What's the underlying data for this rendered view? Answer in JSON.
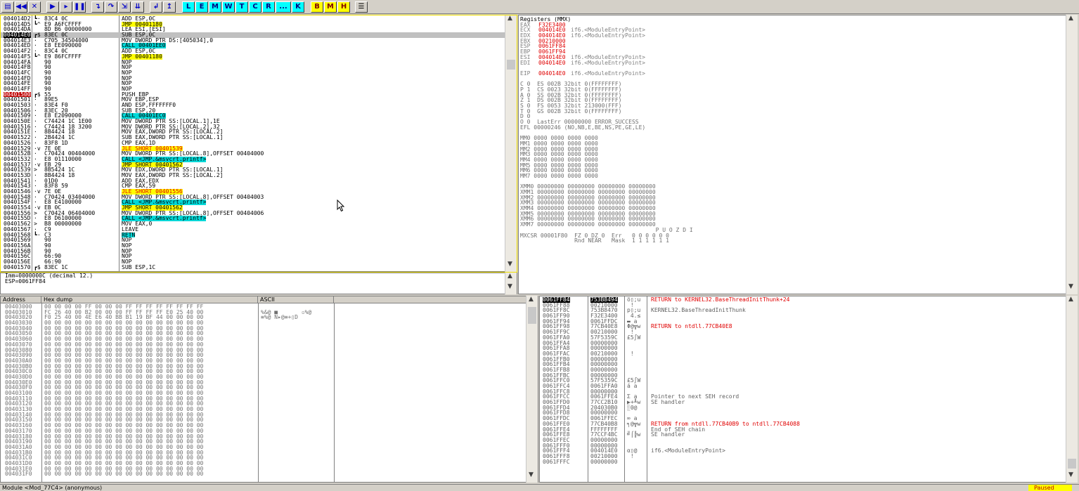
{
  "toolbar": {
    "buttons": [
      {
        "name": "open-icon",
        "glyph": "▤"
      },
      {
        "name": "restart-icon",
        "glyph": "◀◀"
      },
      {
        "name": "close-icon",
        "glyph": "✕"
      },
      {
        "name": "run-icon",
        "glyph": "▶"
      },
      {
        "name": "step-icon",
        "glyph": "▸"
      },
      {
        "name": "pause-icon",
        "glyph": "❚❚"
      },
      {
        "name": "step-into-icon",
        "glyph": "↴"
      },
      {
        "name": "step-over-icon",
        "glyph": "↷"
      },
      {
        "name": "trace-into-icon",
        "glyph": "⇲"
      },
      {
        "name": "trace-over-icon",
        "glyph": "⇊"
      },
      {
        "name": "execute-till-return-icon",
        "glyph": "↲"
      },
      {
        "name": "go-to-icon",
        "glyph": "↥"
      }
    ],
    "letters_cyan": [
      "L",
      "E",
      "M",
      "W",
      "T",
      "C",
      "R",
      "...",
      "K"
    ],
    "letters_yellow": [
      "B",
      "M",
      "H"
    ],
    "menu_glyph": "☰"
  },
  "cpu": {
    "rows": [
      {
        "addr": "004014D2",
        "br": "┗·",
        "hex": "83C4 0C",
        "asm": "ADD ESP,0C"
      },
      {
        "addr": "004014D5",
        "br": "┗^",
        "hex": "E9 A6FCFFFF",
        "asm": "JMP 00401180",
        "t": "yjmp"
      },
      {
        "addr": "004014DA",
        "br": " ",
        "hex": "8D B6 00000000",
        "asm": "LEA ESI,[ESI]"
      },
      {
        "addr": "004014E0",
        "br": "┏$",
        "hex": "83EC 0C",
        "asm": "SUB ESP,0C",
        "sel": true
      },
      {
        "addr": "004014E3",
        "br": "·",
        "hex": "C705 34504000",
        "asm": "MOV DWORD PTR DS:[405034],0"
      },
      {
        "addr": "004014ED",
        "br": "·",
        "hex": "E8 EE090000",
        "asm": "CALL 00401EE0",
        "t": "ycall"
      },
      {
        "addr": "004014F2",
        "br": "·",
        "hex": "83C4 0C",
        "asm": "ADD ESP,0C"
      },
      {
        "addr": "004014F5",
        "br": "┗^",
        "hex": "E9 86FCFFFF",
        "asm": "JMP 00401180",
        "t": "yjmp"
      },
      {
        "addr": "004014FA",
        "br": " ",
        "hex": "90",
        "asm": "NOP"
      },
      {
        "addr": "004014FB",
        "br": " ",
        "hex": "90",
        "asm": "NOP"
      },
      {
        "addr": "004014FC",
        "br": " ",
        "hex": "90",
        "asm": "NOP"
      },
      {
        "addr": "004014FD",
        "br": " ",
        "hex": "90",
        "asm": "NOP"
      },
      {
        "addr": "004014FE",
        "br": " ",
        "hex": "90",
        "asm": "NOP"
      },
      {
        "addr": "004014FF",
        "br": " ",
        "hex": "90",
        "asm": "NOP"
      },
      {
        "addr": "00401500",
        "br": "┏$",
        "hex": "55",
        "asm": "PUSH EBP",
        "bp": true
      },
      {
        "addr": "00401501",
        "br": "·",
        "hex": "89E5",
        "asm": "MOV EBP,ESP"
      },
      {
        "addr": "00401503",
        "br": "·",
        "hex": "83E4 F0",
        "asm": "AND ESP,FFFFFFF0"
      },
      {
        "addr": "00401506",
        "br": "·",
        "hex": "83EC 20",
        "asm": "SUB ESP,20"
      },
      {
        "addr": "00401509",
        "br": "·",
        "hex": "E8 E2090000",
        "asm": "CALL 00401EC0",
        "t": "ycall"
      },
      {
        "addr": "0040150E",
        "br": "·",
        "hex": "C74424 1C 1E00",
        "asm": "MOV DWORD PTR SS:[LOCAL.1],1E"
      },
      {
        "addr": "00401516",
        "br": "·",
        "hex": "C74424 18 3200",
        "asm": "MOV DWORD PTR SS:[LOCAL.2],32"
      },
      {
        "addr": "0040151E",
        "br": "·",
        "hex": "8B4424 18",
        "asm": "MOV EAX,DWORD PTR SS:[LOCAL.2]"
      },
      {
        "addr": "00401522",
        "br": "·",
        "hex": "2B4424 1C",
        "asm": "SUB EAX,DWORD PTR SS:[LOCAL.1]"
      },
      {
        "addr": "00401526",
        "br": "·",
        "hex": "83F8 1D",
        "asm": "CMP EAX,1D"
      },
      {
        "addr": "00401529",
        "br": "·v",
        "hex": "7E 0E",
        "asm": "JLE SHORT 00401539",
        "t": "yjmp",
        "red": true
      },
      {
        "addr": "0040152B",
        "br": "·",
        "hex": "C70424 00404000",
        "asm": "MOV DWORD PTR SS:[LOCAL.8],OFFSET 00404000"
      },
      {
        "addr": "00401532",
        "br": "·",
        "hex": "E8 01110000",
        "asm": "CALL <JMP.&msvcrt.printf>",
        "t": "ycall"
      },
      {
        "addr": "00401537",
        "br": "·v",
        "hex": "EB 29",
        "asm": "JMP SHORT 00401562",
        "t": "yjmp"
      },
      {
        "addr": "00401539",
        "br": ">",
        "hex": "8B5424 1C",
        "asm": "MOV EDX,DWORD PTR SS:[LOCAL.1]"
      },
      {
        "addr": "0040153D",
        "br": "·",
        "hex": "8B4424 18",
        "asm": "MOV EAX,DWORD PTR SS:[LOCAL.2]"
      },
      {
        "addr": "00401541",
        "br": "·",
        "hex": "01D0",
        "asm": "ADD EAX,EDX"
      },
      {
        "addr": "00401543",
        "br": "·",
        "hex": "83F8 59",
        "asm": "CMP EAX,59"
      },
      {
        "addr": "00401546",
        "br": "·v",
        "hex": "7E 0E",
        "asm": "JLE SHORT 00401556",
        "t": "yjmp",
        "red": true
      },
      {
        "addr": "00401548",
        "br": "·",
        "hex": "C70424 03404000",
        "asm": "MOV DWORD PTR SS:[LOCAL.8],OFFSET 00404003"
      },
      {
        "addr": "0040154F",
        "br": "·",
        "hex": "E8 E4100000",
        "asm": "CALL <JMP.&msvcrt.printf>",
        "t": "ycall"
      },
      {
        "addr": "00401554",
        "br": "·v",
        "hex": "EB 0C",
        "asm": "JMP SHORT 00401562",
        "t": "yjmp"
      },
      {
        "addr": "00401556",
        "br": ">",
        "hex": "C70424 06404000",
        "asm": "MOV DWORD PTR SS:[LOCAL.8],OFFSET 00404006"
      },
      {
        "addr": "0040155D",
        "br": "·",
        "hex": "E8 D6100000",
        "asm": "CALL <JMP.&msvcrt.printf>",
        "t": "ycall"
      },
      {
        "addr": "00401562",
        "br": ">",
        "hex": "B8 00000000",
        "asm": "MOV EAX,0"
      },
      {
        "addr": "00401567",
        "br": "·",
        "hex": "C9",
        "asm": "LEAVE"
      },
      {
        "addr": "00401568",
        "br": "┗·",
        "hex": "C3",
        "asm": "RETN",
        "t": "ycall"
      },
      {
        "addr": "00401569",
        "br": " ",
        "hex": "90",
        "asm": "NOP"
      },
      {
        "addr": "0040156A",
        "br": " ",
        "hex": "90",
        "asm": "NOP"
      },
      {
        "addr": "0040156B",
        "br": " ",
        "hex": "90",
        "asm": "NOP"
      },
      {
        "addr": "0040156C",
        "br": " ",
        "hex": "66:90",
        "asm": "NOP"
      },
      {
        "addr": "0040156E",
        "br": " ",
        "hex": "66:90",
        "asm": "NOP"
      },
      {
        "addr": "00401570",
        "br": "┏$",
        "hex": "83EC 1C",
        "asm": "SUB ESP,1C"
      }
    ],
    "info_line1": "Imm=0000000C (decimal 12.)",
    "info_line2": "ESP=0061FF84"
  },
  "registers": {
    "title": "Registers (MMX)",
    "gp": [
      {
        "name": "EAX",
        "val": "F32E3400",
        "c": "",
        "changed": true
      },
      {
        "name": "ECX",
        "val": "004014E0",
        "c": "if6.<ModuleEntryPoint>",
        "changed": true
      },
      {
        "name": "EDX",
        "val": "004014E0",
        "c": "if6.<ModuleEntryPoint>",
        "changed": true
      },
      {
        "name": "EBX",
        "val": "00210000",
        "c": "",
        "changed": true
      },
      {
        "name": "ESP",
        "val": "0061FF84",
        "c": "",
        "changed": true
      },
      {
        "name": "EBP",
        "val": "0061FF94",
        "c": "",
        "changed": true
      },
      {
        "name": "ESI",
        "val": "004014E0",
        "c": "if6.<ModuleEntryPoint>",
        "changed": true
      },
      {
        "name": "EDI",
        "val": "004014E0",
        "c": "if6.<ModuleEntryPoint>",
        "changed": true
      }
    ],
    "eip": {
      "name": "EIP",
      "val": "004014E0",
      "c": "if6.<ModuleEntryPoint>"
    },
    "flags": [
      "C 0  ES 002B 32bit 0(FFFFFFFF)",
      "P 1  CS 0023 32bit 0(FFFFFFFF)",
      "A 0  SS 002B 32bit 0(FFFFFFFF)",
      "Z 1  DS 002B 32bit 0(FFFFFFFF)",
      "S 0  FS 0053 32bit 213000(FFF)",
      "T 0  GS 002B 32bit 0(FFFFFFFF)",
      "D 0",
      "O 0  LastErr 00000000 ERROR_SUCCESS"
    ],
    "efl": "EFL 00000246 (NO,NB,E,BE,NS,PE,GE,LE)",
    "mm": [
      "MM0 0000 0000 0000 0000",
      "MM1 0000 0000 0000 0000",
      "MM2 0000 0000 0000 0000",
      "MM3 0000 0000 0000 0000",
      "MM4 0000 0000 0000 0000",
      "MM5 0000 0000 0000 0000",
      "MM6 0000 0000 0000 0000",
      "MM7 0000 0000 0000 0000"
    ],
    "xmm": [
      "XMM0 00000000 00000000 00000000 00000000",
      "XMM1 00000000 00000000 00000000 00000000",
      "XMM2 00000000 00000000 00000000 00000000",
      "XMM3 00000000 00000000 00000000 00000000",
      "XMM4 00000000 00000000 00000000 00000000",
      "XMM5 00000000 00000000 00000000 00000000",
      "XMM6 00000000 00000000 00000000 00000000",
      "XMM7 00000000 00000000 00000000 00000000"
    ],
    "mxcsr1": "                                        P U O Z D I",
    "mxcsr2": "MXCSR 00001F80  FZ 0 DZ 0  Err   0 0 0 0 0 0",
    "mxcsr3": "                Rnd NEAR   Mask  1 1 1 1 1 1"
  },
  "dump": {
    "hdr_address": "Address",
    "hdr_hex": "Hex dump",
    "hdr_ascii": "ASCII",
    "rows": [
      {
        "a": "00403000",
        "h": "00 00 00 00 FF 00 00 00 FF FF FF FF FF FF FF FF",
        "s": ""
      },
      {
        "a": "00403010",
        "h": "FC 26 40 00 B2 00 00 00 FF FF FF FF E0 25 40 00",
        "s": "%&@ ■       ▫%@"
      },
      {
        "a": "00403020",
        "h": "F0 25 40 00 4E E6 40 BB B1 19 BF 44 00 00 00 00",
        "s": "≡%@ N▸@≡+▯D"
      },
      {
        "a": "00403030",
        "h": "00 00 00 00 00 00 00 00 00 00 00 00 00 00 00 00",
        "s": ""
      },
      {
        "a": "00403040",
        "h": "00 00 00 00 00 00 00 00 00 00 00 00 00 00 00 00",
        "s": ""
      },
      {
        "a": "00403050",
        "h": "00 00 00 00 00 00 00 00 00 00 00 00 00 00 00 00",
        "s": ""
      },
      {
        "a": "00403060",
        "h": "00 00 00 00 00 00 00 00 00 00 00 00 00 00 00 00",
        "s": ""
      },
      {
        "a": "00403070",
        "h": "00 00 00 00 00 00 00 00 00 00 00 00 00 00 00 00",
        "s": ""
      },
      {
        "a": "00403080",
        "h": "00 00 00 00 00 00 00 00 00 00 00 00 00 00 00 00",
        "s": ""
      },
      {
        "a": "00403090",
        "h": "00 00 00 00 00 00 00 00 00 00 00 00 00 00 00 00",
        "s": ""
      },
      {
        "a": "004030A0",
        "h": "00 00 00 00 00 00 00 00 00 00 00 00 00 00 00 00",
        "s": ""
      },
      {
        "a": "004030B0",
        "h": "00 00 00 00 00 00 00 00 00 00 00 00 00 00 00 00",
        "s": ""
      },
      {
        "a": "004030C0",
        "h": "00 00 00 00 00 00 00 00 00 00 00 00 00 00 00 00",
        "s": ""
      },
      {
        "a": "004030D0",
        "h": "00 00 00 00 00 00 00 00 00 00 00 00 00 00 00 00",
        "s": ""
      },
      {
        "a": "004030E0",
        "h": "00 00 00 00 00 00 00 00 00 00 00 00 00 00 00 00",
        "s": ""
      },
      {
        "a": "004030F0",
        "h": "00 00 00 00 00 00 00 00 00 00 00 00 00 00 00 00",
        "s": ""
      },
      {
        "a": "00403100",
        "h": "00 00 00 00 00 00 00 00 00 00 00 00 00 00 00 00",
        "s": ""
      },
      {
        "a": "00403110",
        "h": "00 00 00 00 00 00 00 00 00 00 00 00 00 00 00 00",
        "s": ""
      },
      {
        "a": "00403120",
        "h": "00 00 00 00 00 00 00 00 00 00 00 00 00 00 00 00",
        "s": ""
      },
      {
        "a": "00403130",
        "h": "00 00 00 00 00 00 00 00 00 00 00 00 00 00 00 00",
        "s": ""
      },
      {
        "a": "00403140",
        "h": "00 00 00 00 00 00 00 00 00 00 00 00 00 00 00 00",
        "s": ""
      },
      {
        "a": "00403150",
        "h": "00 00 00 00 00 00 00 00 00 00 00 00 00 00 00 00",
        "s": ""
      },
      {
        "a": "00403160",
        "h": "00 00 00 00 00 00 00 00 00 00 00 00 00 00 00 00",
        "s": ""
      },
      {
        "a": "00403170",
        "h": "00 00 00 00 00 00 00 00 00 00 00 00 00 00 00 00",
        "s": ""
      },
      {
        "a": "00403180",
        "h": "00 00 00 00 00 00 00 00 00 00 00 00 00 00 00 00",
        "s": ""
      },
      {
        "a": "00403190",
        "h": "00 00 00 00 00 00 00 00 00 00 00 00 00 00 00 00",
        "s": ""
      },
      {
        "a": "004031A0",
        "h": "00 00 00 00 00 00 00 00 00 00 00 00 00 00 00 00",
        "s": ""
      },
      {
        "a": "004031B0",
        "h": "00 00 00 00 00 00 00 00 00 00 00 00 00 00 00 00",
        "s": ""
      },
      {
        "a": "004031C0",
        "h": "00 00 00 00 00 00 00 00 00 00 00 00 00 00 00 00",
        "s": ""
      },
      {
        "a": "004031D0",
        "h": "00 00 00 00 00 00 00 00 00 00 00 00 00 00 00 00",
        "s": ""
      },
      {
        "a": "004031E0",
        "h": "00 00 00 00 00 00 00 00 00 00 00 00 00 00 00 00",
        "s": ""
      },
      {
        "a": "004031F0",
        "h": "00 00 00 00 00 00 00 00 00 00 00 00 00 00 00 00",
        "s": ""
      }
    ]
  },
  "stack": {
    "rows": [
      {
        "a": "0061FF84",
        "v": "753B8494",
        "s": "ö▯;u",
        "c": "RETURN to KERNEL32.BaseThreadInitThunk+24",
        "red": true,
        "sel": true
      },
      {
        "a": "0061FF88",
        "v": "00210000",
        "s": " !",
        "c": ""
      },
      {
        "a": "0061FF8C",
        "v": "753B8470",
        "s": "p▯;u",
        "c": "KERNEL32.BaseThreadInitThunk"
      },
      {
        "a": "0061FF90",
        "v": "F32E3400",
        "s": " 4.≤",
        "c": ""
      },
      {
        "a": "0061FF94",
        "v": "0061FFDC",
        "s": "▬ a",
        "c": ""
      },
      {
        "a": "0061FF98",
        "v": "77CB40E8",
        "s": "Φ@╦w",
        "c": "RETURN to ntdll.77CB40E8",
        "red": true
      },
      {
        "a": "0061FF9C",
        "v": "00210000",
        "s": " !",
        "c": ""
      },
      {
        "a": "0061FFA0",
        "v": "57F5359C",
        "s": "£5∫W",
        "c": ""
      },
      {
        "a": "0061FFA4",
        "v": "00000000",
        "s": "",
        "c": ""
      },
      {
        "a": "0061FFA8",
        "v": "00000000",
        "s": "",
        "c": ""
      },
      {
        "a": "0061FFAC",
        "v": "00210000",
        "s": " !",
        "c": ""
      },
      {
        "a": "0061FFB0",
        "v": "00000000",
        "s": "",
        "c": ""
      },
      {
        "a": "0061FFB4",
        "v": "00000000",
        "s": "",
        "c": ""
      },
      {
        "a": "0061FFB8",
        "v": "00000000",
        "s": "",
        "c": ""
      },
      {
        "a": "0061FFBC",
        "v": "00000000",
        "s": "",
        "c": ""
      },
      {
        "a": "0061FFC0",
        "v": "57F5359C",
        "s": "£5∫W",
        "c": ""
      },
      {
        "a": "0061FFC4",
        "v": "0061FFA0",
        "s": "á a",
        "c": ""
      },
      {
        "a": "0061FFC8",
        "v": "00000000",
        "s": "",
        "c": ""
      },
      {
        "a": "0061FFCC",
        "v": "0061FFE4",
        "s": "Σ a",
        "c": "Pointer to next SEH record"
      },
      {
        "a": "0061FFD0",
        "v": "77CC2B10",
        "s": "▶+╨w",
        "c": "SE handler"
      },
      {
        "a": "0061FFD4",
        "v": "204030B0",
        "s": "░0@",
        "c": ""
      },
      {
        "a": "0061FFD8",
        "v": "00000000",
        "s": "",
        "c": ""
      },
      {
        "a": "0061FFDC",
        "v": "0061FFEC",
        "s": "∞ a",
        "c": ""
      },
      {
        "a": "0061FFE0",
        "v": "77CB40B8",
        "s": "╕@╦w",
        "c": "RETURN from ntdll.77CB40B9 to ntdll.77CB4088",
        "red": true
      },
      {
        "a": "0061FFE4",
        "v": "FFFFFFFF",
        "s": "",
        "c": "End of SEH chain"
      },
      {
        "a": "0061FFE8",
        "v": "77CCF4BC",
        "s": "╝⌠╠w",
        "c": "SE handler"
      },
      {
        "a": "0061FFEC",
        "v": "00000000",
        "s": "",
        "c": ""
      },
      {
        "a": "0061FFF0",
        "v": "00000000",
        "s": "",
        "c": ""
      },
      {
        "a": "0061FFF4",
        "v": "004014E0",
        "s": "α▯@",
        "c": "if6.<ModuleEntryPoint>"
      },
      {
        "a": "0061FFF8",
        "v": "00210000",
        "s": " !",
        "c": ""
      },
      {
        "a": "0061FFFC",
        "v": "00000000",
        "s": "",
        "c": ""
      }
    ]
  },
  "status": {
    "left": "Module <Mod_77C4> (anonymous)",
    "right": "Paused"
  },
  "colors": {
    "call": "#00d8d8",
    "jmp": "#ffff00",
    "changed": "#e00000",
    "paused_bg": "#ffff00"
  }
}
